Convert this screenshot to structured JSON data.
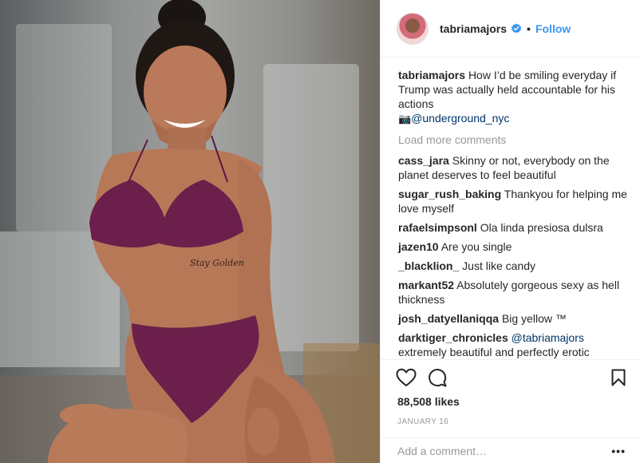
{
  "post": {
    "username": "tabriamajors",
    "follow_label": "Follow",
    "dot": "•",
    "caption_user": "tabriamajors",
    "caption_text": "How I’d be smiling everyday if Trump was actually held accountable for his actions",
    "caption_cam": "📷",
    "caption_mention": "@underground_nyc",
    "load_more": "Load more comments",
    "likes": "88,508 likes",
    "date": "JANUARY 16",
    "add_comment_placeholder": "Add a comment…",
    "more": "•••",
    "photo_tattoo": "Stay Golden"
  },
  "comments": [
    {
      "user": "cass_jara",
      "text": "Skinny or not, everybody on the planet deserves to feel beautiful"
    },
    {
      "user": "sugar_rush_baking",
      "text": "Thankyou for helping me love myself"
    },
    {
      "user": "rafaelsimpsonl",
      "text": "Ola linda presiosa dulsra"
    },
    {
      "user": "jazen10",
      "text": "Are you single"
    },
    {
      "user": "_blacklion_",
      "text": "Just like candy"
    },
    {
      "user": "markant52",
      "text": "Absolutely gorgeous sexy as hell thickness"
    },
    {
      "user": "josh_datyellaniqqa",
      "text": "Big yellow ™"
    },
    {
      "user": "darktiger_chronicles",
      "mention": "@tabriamajors",
      "text": "extremely beautiful and perfectly erotic"
    }
  ],
  "colors": {
    "link": "#3897f0",
    "mention": "#003569",
    "muted": "#999999",
    "text": "#262626",
    "lingerie": "#6b1f4a"
  },
  "icons": [
    "verified-badge-icon",
    "heart-icon",
    "comment-icon",
    "bookmark-icon",
    "more-options-icon"
  ]
}
